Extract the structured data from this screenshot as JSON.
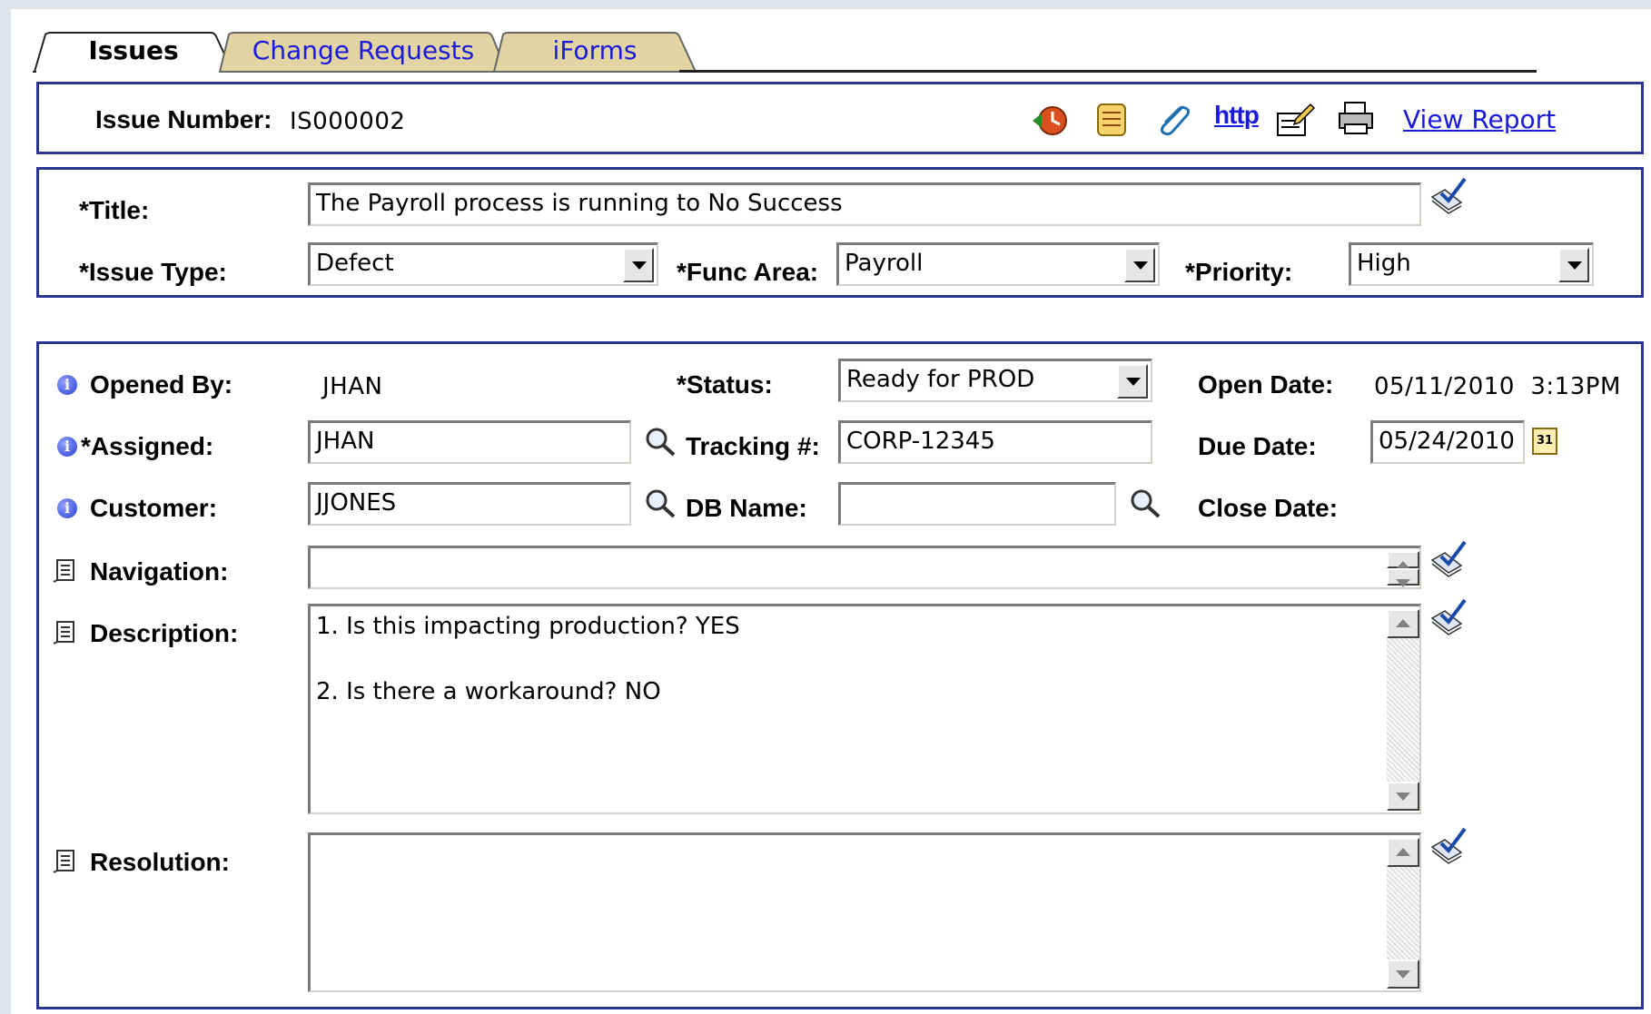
{
  "tabs": [
    {
      "label": "Issues",
      "active": true
    },
    {
      "label": "Change Requests",
      "active": false
    },
    {
      "label": "iForms",
      "active": false
    }
  ],
  "header": {
    "issue_number_label": "Issue Number:",
    "issue_number": "IS000002",
    "toolbar_icons": [
      "history-icon",
      "scroll-icon",
      "attachment-icon",
      "http-link-icon",
      "edit-doc-icon",
      "print-icon"
    ],
    "http_label": "http",
    "view_report": "View Report"
  },
  "issue": {
    "title_label": "*Title:",
    "title": "The Payroll process is running to No Success",
    "issue_type_label": "*Issue Type:",
    "issue_type": "Defect",
    "func_area_label": "*Func Area:",
    "func_area": "Payroll",
    "priority_label": "*Priority:",
    "priority": "High"
  },
  "details": {
    "opened_by_label": "Opened By:",
    "opened_by": "JHAN",
    "assigned_label": "*Assigned:",
    "assigned": "JHAN",
    "customer_label": "Customer:",
    "customer": "JJONES",
    "status_label": "*Status:",
    "status": "Ready for PROD",
    "tracking_label": "Tracking #:",
    "tracking": "CORP-12345",
    "db_name_label": "DB Name:",
    "db_name": "",
    "open_date_label": "Open Date:",
    "open_date": "05/11/2010  3:13PM",
    "due_date_label": "Due Date:",
    "due_date": "05/24/2010",
    "close_date_label": "Close Date:",
    "calendar_day": "31",
    "navigation_label": "Navigation:",
    "navigation": "",
    "description_label": "Description:",
    "description": "1. Is this impacting production? YES\n\n2. Is there a workaround? NO",
    "resolution_label": "Resolution:",
    "resolution": ""
  },
  "colors": {
    "group_border": "#2b3591",
    "link": "#1a1adb",
    "tab_inactive": "#e3d4a3"
  }
}
